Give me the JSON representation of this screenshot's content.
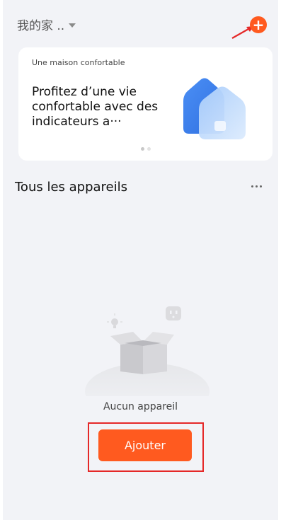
{
  "header": {
    "home_name": "我的家 ..",
    "add_icon_symbol": "+"
  },
  "banner": {
    "subtitle": "Une maison confortable",
    "headline": "Profitez d’une vie confortable avec des indicateurs a···"
  },
  "devices": {
    "title": "Tous les appareils",
    "empty_text": "Aucun appareil",
    "add_button_label": "Ajouter"
  },
  "colors": {
    "accent": "#ff5a1f",
    "annotation": "#e52828",
    "background": "#f2f3f7"
  },
  "icons": [
    "caret-down-icon",
    "add-icon",
    "more-icon",
    "bulb-icon",
    "socket-icon",
    "box-icon",
    "house-icon"
  ]
}
